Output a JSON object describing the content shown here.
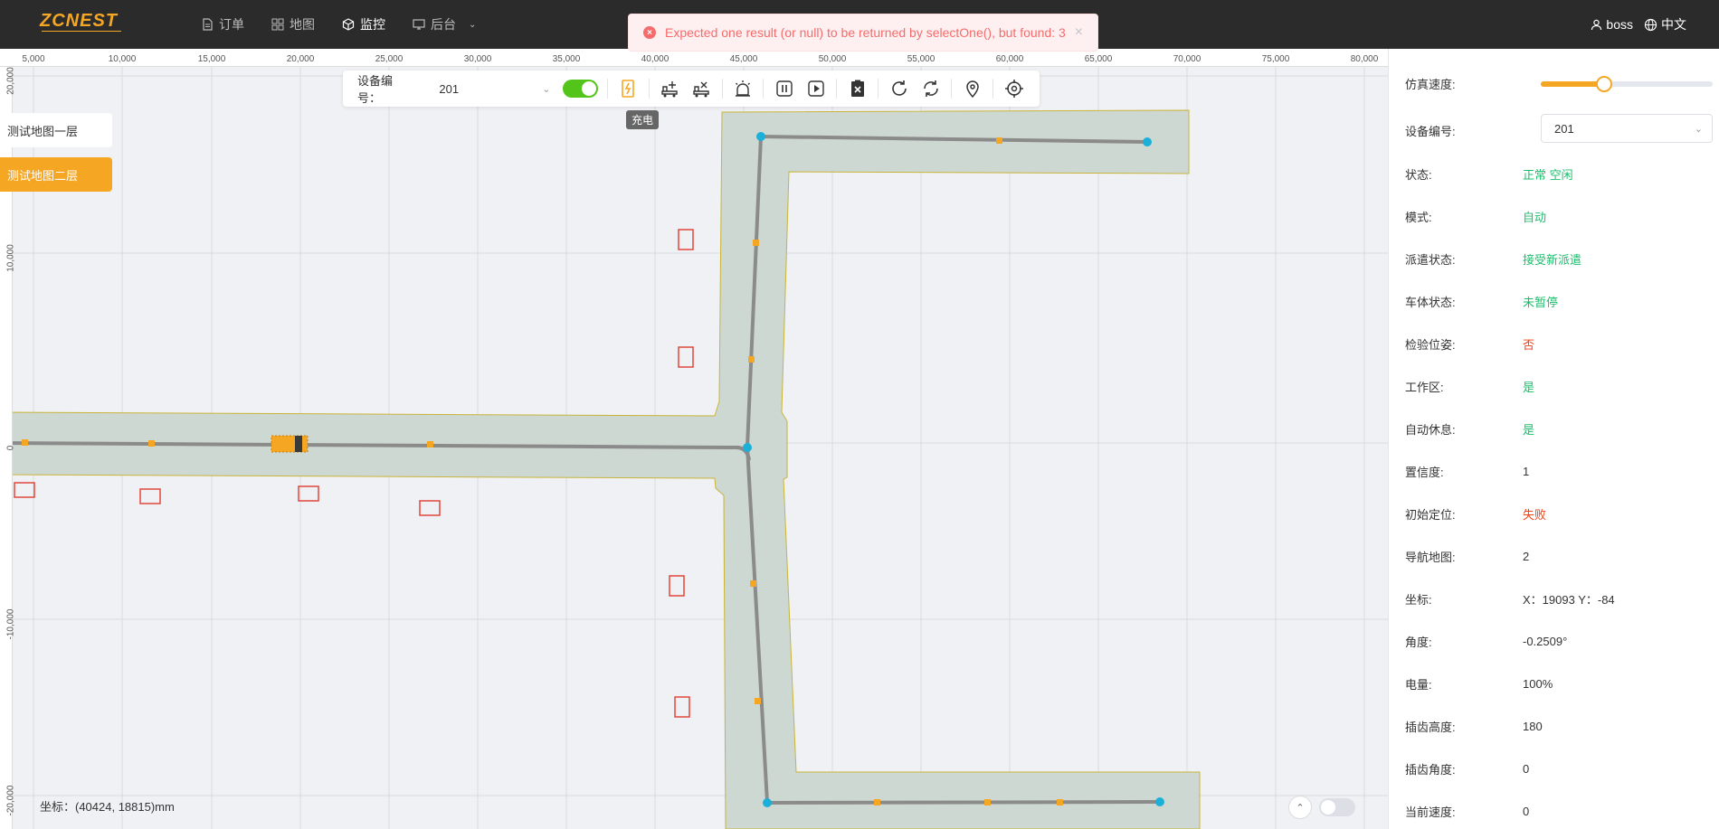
{
  "app": {
    "logo_text": "ZCNEST",
    "nav": [
      {
        "label": "订单",
        "icon": "document-icon"
      },
      {
        "label": "地图",
        "icon": "sitemap-icon"
      },
      {
        "label": "监控",
        "icon": "cube-icon",
        "active": true
      },
      {
        "label": "后台",
        "icon": "monitor-icon"
      }
    ],
    "user": "boss",
    "language": "中文"
  },
  "toast": {
    "message": "Expected one result (or null) to be returned by selectOne(), but found: 3"
  },
  "map": {
    "ruler_x": [
      "5,000",
      "10,000",
      "15,000",
      "20,000",
      "25,000",
      "30,000",
      "35,000",
      "40,000",
      "45,000",
      "50,000",
      "55,000",
      "60,000",
      "65,000",
      "70,000",
      "75,000",
      "80,000"
    ],
    "ruler_y": [
      "20,000",
      "10,000",
      "0",
      "-10,000",
      "-20,000"
    ],
    "floors": [
      "测试地图一层",
      "测试地图二层"
    ],
    "active_floor": 1,
    "coordinate_readout": "坐标：(40424, 18815)mm"
  },
  "toolbar": {
    "device_label": "设备编号：",
    "device_value": "201",
    "auto_on": true,
    "tooltip": "充电",
    "icons": [
      "charge-icon",
      "add-load-icon",
      "remove-load-icon",
      "alarm-icon",
      "pause-icon",
      "play-icon",
      "clear-task-icon",
      "refresh-icon",
      "sync-icon",
      "location-pin-icon",
      "target-icon"
    ]
  },
  "panel": {
    "sim_speed_label": "仿真速度:",
    "sim_speed_fraction": 0.37,
    "device_label": "设备编号:",
    "device_value": "201",
    "rows": [
      {
        "k": "状态:",
        "v": "正常   空闲",
        "color": "green"
      },
      {
        "k": "模式:",
        "v": "自动",
        "color": "green"
      },
      {
        "k": "派遣状态:",
        "v": "接受新派遣",
        "color": "green"
      },
      {
        "k": "车体状态:",
        "v": "未暂停",
        "color": "green"
      },
      {
        "k": "检验位姿:",
        "v": "否",
        "color": "red"
      },
      {
        "k": "工作区:",
        "v": "是",
        "color": "green"
      },
      {
        "k": "自动休息:",
        "v": "是",
        "color": "green"
      },
      {
        "k": "置信度:",
        "v": "1",
        "color": ""
      },
      {
        "k": "初始定位:",
        "v": "失败",
        "color": "red"
      },
      {
        "k": "导航地图:",
        "v": "2",
        "color": ""
      },
      {
        "k": "坐标:",
        "v": "X：19093 Y：-84",
        "color": ""
      },
      {
        "k": "角度:",
        "v": "-0.2509°",
        "color": ""
      },
      {
        "k": "电量:",
        "v": "100%",
        "color": ""
      },
      {
        "k": "插齿高度:",
        "v": "180",
        "color": ""
      },
      {
        "k": "插齿角度:",
        "v": "0",
        "color": ""
      },
      {
        "k": "当前速度:",
        "v": "0",
        "color": ""
      }
    ]
  },
  "colors": {
    "accent": "#f5a623",
    "green": "#19be6b",
    "red": "#ed4014",
    "lane": "#cdd8d2",
    "node": "#1cb0d8"
  }
}
